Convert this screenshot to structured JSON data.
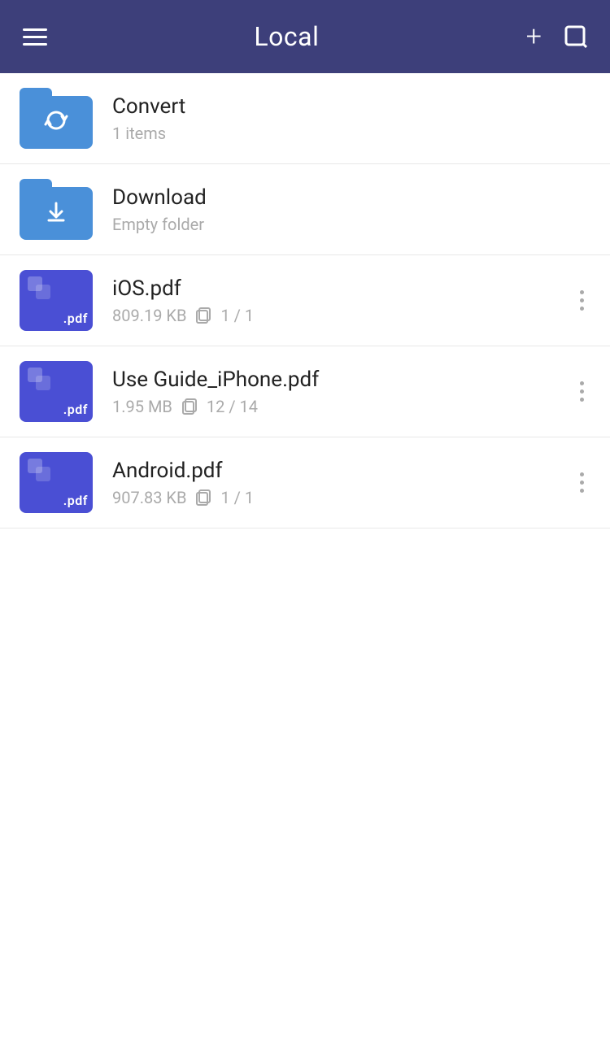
{
  "header": {
    "title": "Local",
    "add_label": "+",
    "menu_label": "Menu",
    "edit_label": "Edit"
  },
  "items": [
    {
      "id": "convert",
      "type": "folder",
      "name": "Convert",
      "meta": "1 items",
      "has_more": false,
      "icon_type": "convert"
    },
    {
      "id": "download",
      "type": "folder",
      "name": "Download",
      "meta": "Empty folder",
      "has_more": false,
      "icon_type": "download"
    },
    {
      "id": "ios-pdf",
      "type": "pdf",
      "name": "iOS.pdf",
      "size": "809.19 KB",
      "pages": "1 / 1",
      "has_more": true
    },
    {
      "id": "use-guide-iphone",
      "type": "pdf",
      "name": "Use Guide_iPhone.pdf",
      "size": "1.95 MB",
      "pages": "12 / 14",
      "has_more": true
    },
    {
      "id": "android-pdf",
      "type": "pdf",
      "name": "Android.pdf",
      "size": "907.83 KB",
      "pages": "1 / 1",
      "has_more": true
    }
  ],
  "colors": {
    "header_bg": "#3d3f7a",
    "folder_blue": "#4a90d9",
    "pdf_purple": "#4a4fd4"
  }
}
